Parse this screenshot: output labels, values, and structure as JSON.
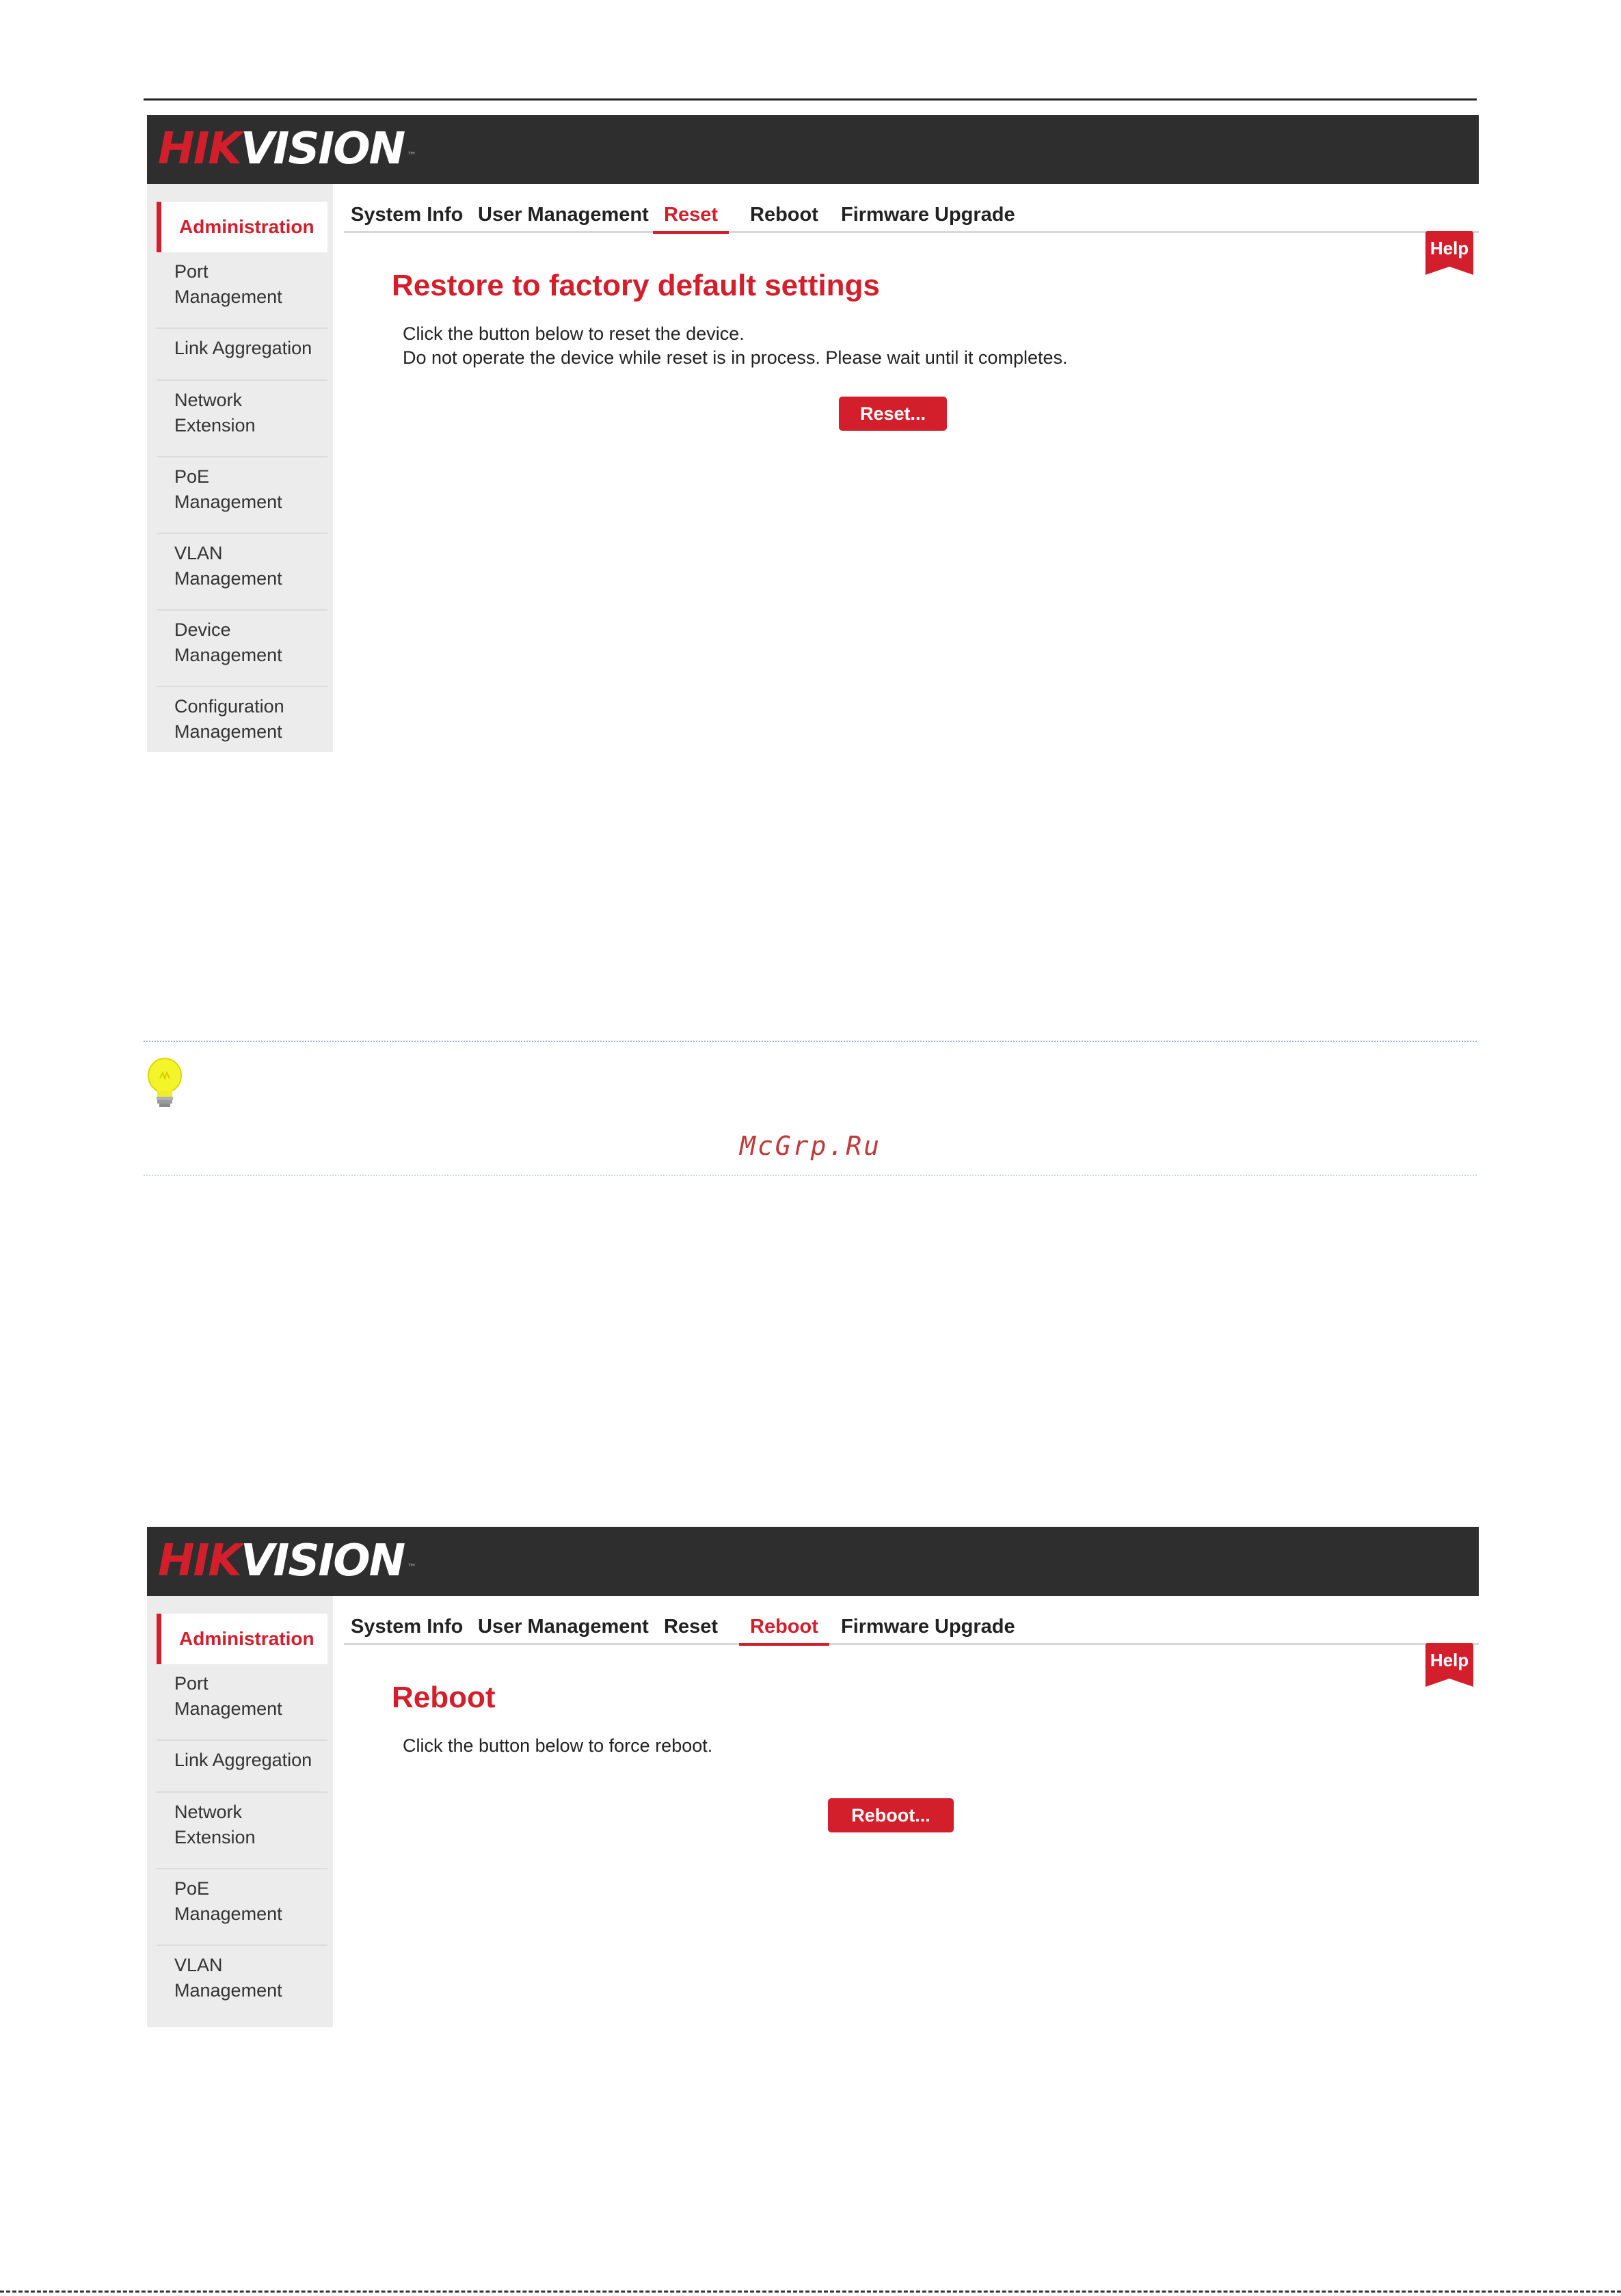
{
  "brand": {
    "logo_red": "HIK",
    "logo_white": "VISION",
    "trademark": "™"
  },
  "reset_screen": {
    "sidebar": {
      "active": "Administration",
      "items": [
        "Port\nManagement",
        "Link Aggregation",
        "Network\nExtension",
        "PoE\nManagement",
        "VLAN\nManagement",
        "Device\nManagement",
        "Configuration\nManagement"
      ]
    },
    "tabs": [
      "System Info",
      "User Management",
      "Reset",
      "Reboot",
      "Firmware Upgrade"
    ],
    "active_tab": "Reset",
    "help_label": "Help",
    "title": "Restore to factory default settings",
    "desc_line1": "Click the button below to reset the device.",
    "desc_line2": "Do not operate the device while reset is in process. Please wait until it completes.",
    "button_label": "Reset..."
  },
  "note": {
    "watermark": "McGrp.Ru"
  },
  "reboot_screen": {
    "sidebar": {
      "active": "Administration",
      "items": [
        "Port\nManagement",
        "Link Aggregation",
        "Network\nExtension",
        "PoE\nManagement",
        "VLAN\nManagement"
      ]
    },
    "tabs": [
      "System Info",
      "User Management",
      "Reset",
      "Reboot",
      "Firmware Upgrade"
    ],
    "active_tab": "Reboot",
    "help_label": "Help",
    "title": "Reboot",
    "desc_line1": "Click the button below to force reboot.",
    "button_label": "Reboot..."
  },
  "colors": {
    "accent": "#d21f2b",
    "header_bg": "#2e2e2e",
    "sidebar_bg": "#ececec"
  }
}
